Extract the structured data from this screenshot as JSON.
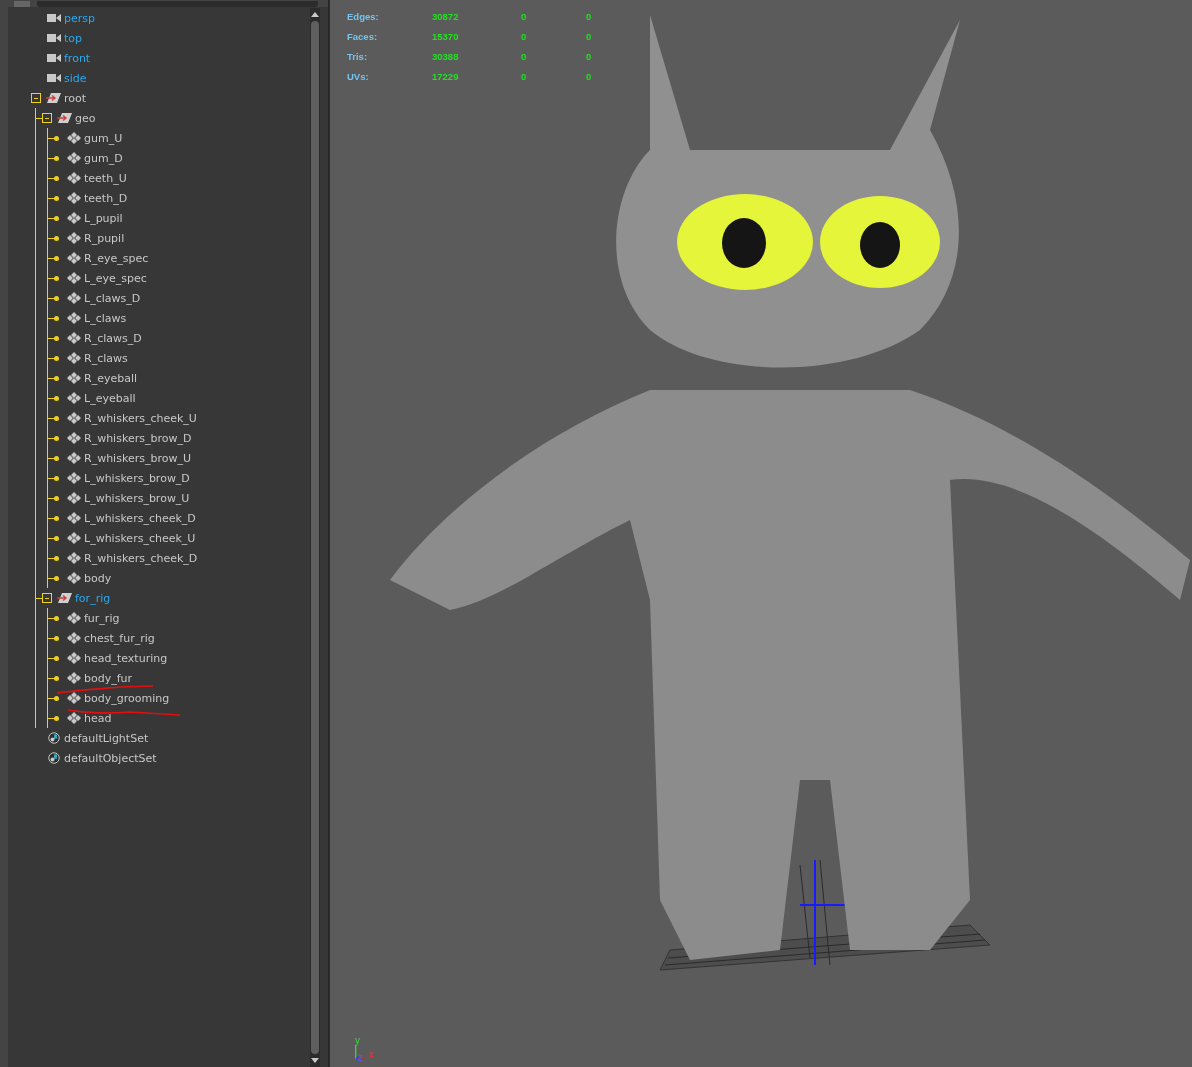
{
  "outliner": {
    "items": [
      {
        "name": "persp",
        "kind": "camera",
        "highlighted": true
      },
      {
        "name": "top",
        "kind": "camera",
        "highlighted": true
      },
      {
        "name": "front",
        "kind": "camera",
        "highlighted": true
      },
      {
        "name": "side",
        "kind": "camera",
        "highlighted": true
      },
      {
        "name": "root",
        "kind": "group",
        "highlighted": false,
        "expanded": true,
        "children": [
          {
            "name": "geo",
            "kind": "group",
            "highlighted": false,
            "expanded": true,
            "children": [
              {
                "name": "gum_U",
                "kind": "mesh",
                "highlighted": false
              },
              {
                "name": "gum_D",
                "kind": "mesh",
                "highlighted": false
              },
              {
                "name": "teeth_U",
                "kind": "mesh",
                "highlighted": false
              },
              {
                "name": "teeth_D",
                "kind": "mesh",
                "highlighted": false
              },
              {
                "name": "L_pupil",
                "kind": "mesh",
                "highlighted": false
              },
              {
                "name": "R_pupil",
                "kind": "mesh",
                "highlighted": false
              },
              {
                "name": "R_eye_spec",
                "kind": "mesh",
                "highlighted": false
              },
              {
                "name": "L_eye_spec",
                "kind": "mesh",
                "highlighted": false
              },
              {
                "name": "L_claws_D",
                "kind": "mesh",
                "highlighted": false
              },
              {
                "name": "L_claws",
                "kind": "mesh",
                "highlighted": false
              },
              {
                "name": "R_claws_D",
                "kind": "mesh",
                "highlighted": false
              },
              {
                "name": "R_claws",
                "kind": "mesh",
                "highlighted": false
              },
              {
                "name": "R_eyeball",
                "kind": "mesh",
                "highlighted": false
              },
              {
                "name": "L_eyeball",
                "kind": "mesh",
                "highlighted": false
              },
              {
                "name": "R_whiskers_cheek_U",
                "kind": "mesh",
                "highlighted": false
              },
              {
                "name": "R_whiskers_brow_D",
                "kind": "mesh",
                "highlighted": false
              },
              {
                "name": "R_whiskers_brow_U",
                "kind": "mesh",
                "highlighted": false
              },
              {
                "name": "L_whiskers_brow_D",
                "kind": "mesh",
                "highlighted": false
              },
              {
                "name": "L_whiskers_brow_U",
                "kind": "mesh",
                "highlighted": false
              },
              {
                "name": "L_whiskers_cheek_D",
                "kind": "mesh",
                "highlighted": false
              },
              {
                "name": "L_whiskers_cheek_U",
                "kind": "mesh",
                "highlighted": false
              },
              {
                "name": "R_whiskers_cheek_D",
                "kind": "mesh",
                "highlighted": false
              },
              {
                "name": "body",
                "kind": "mesh",
                "highlighted": false
              }
            ]
          },
          {
            "name": "for_rig",
            "kind": "group",
            "highlighted": true,
            "expanded": true,
            "children": [
              {
                "name": "fur_rig",
                "kind": "mesh",
                "highlighted": false
              },
              {
                "name": "chest_fur_rig",
                "kind": "mesh",
                "highlighted": false
              },
              {
                "name": "head_texturing",
                "kind": "mesh",
                "highlighted": false
              },
              {
                "name": "body_fur",
                "kind": "mesh",
                "highlighted": false
              },
              {
                "name": "body_grooming",
                "kind": "mesh",
                "highlighted": false
              },
              {
                "name": "head",
                "kind": "mesh",
                "highlighted": false
              }
            ]
          }
        ]
      },
      {
        "name": "defaultLightSet",
        "kind": "set",
        "highlighted": false
      },
      {
        "name": "defaultObjectSet",
        "kind": "set",
        "highlighted": false
      }
    ]
  },
  "viewport": {
    "stats": [
      {
        "label": "Edges:",
        "values": [
          "30872",
          "0",
          "0"
        ]
      },
      {
        "label": "Faces:",
        "values": [
          "15370",
          "0",
          "0"
        ]
      },
      {
        "label": "Tris:",
        "values": [
          "30388",
          "0",
          "0"
        ]
      },
      {
        "label": "UVs:",
        "values": [
          "17229",
          "0",
          "0"
        ]
      }
    ],
    "axis_labels": [
      "y",
      "z",
      "x"
    ]
  }
}
